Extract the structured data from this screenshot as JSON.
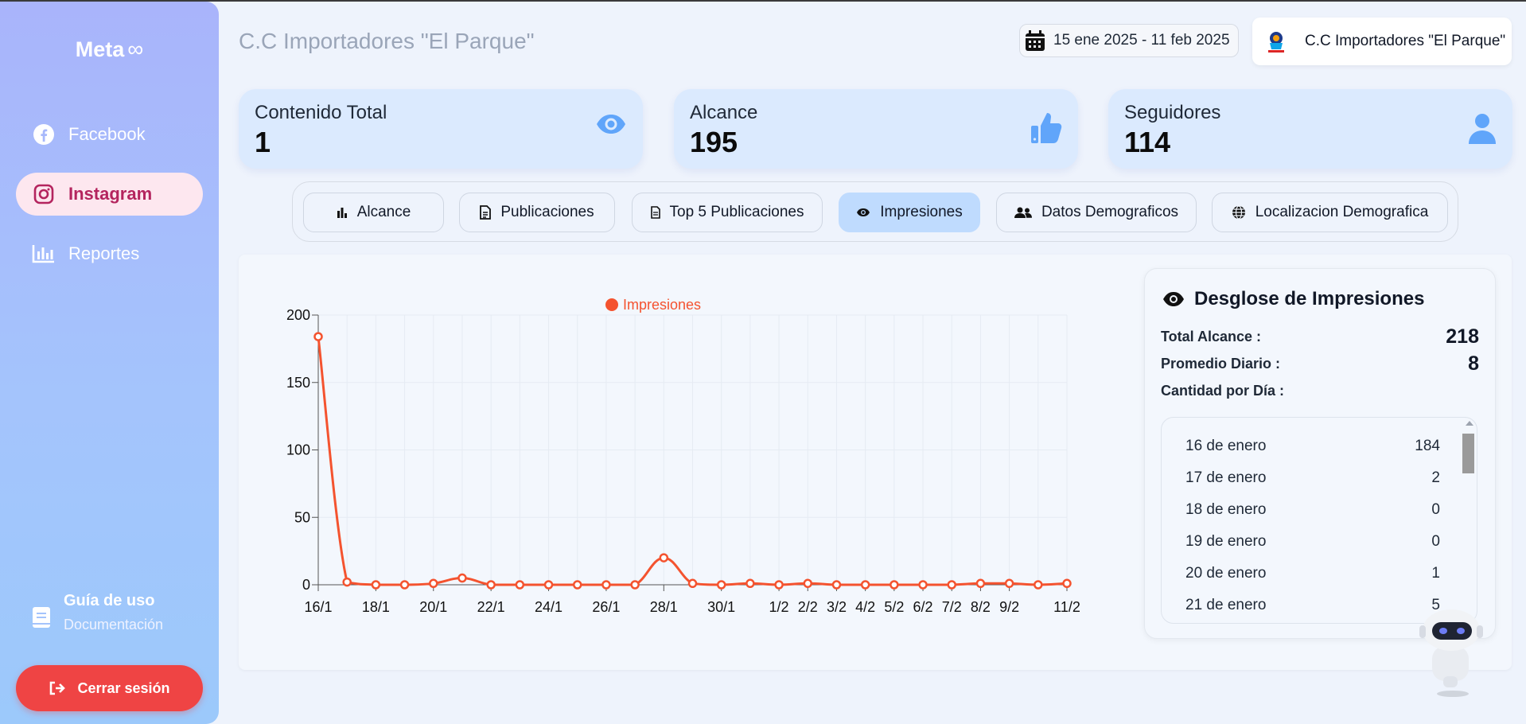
{
  "sidebar": {
    "brand": "Meta",
    "brand_symbol": "∞",
    "items": [
      {
        "label": "Facebook",
        "icon": "facebook-icon",
        "active": false
      },
      {
        "label": "Instagram",
        "icon": "instagram-icon",
        "active": true
      },
      {
        "label": "Reportes",
        "icon": "bar-chart-icon",
        "active": false
      }
    ],
    "guide": {
      "title": "Guía de uso",
      "subtitle": "Documentación"
    },
    "logout": "Cerrar sesión"
  },
  "header": {
    "title": "C.C Importadores \"El Parque\"",
    "date_range": "15 ene 2025 - 11 feb 2025",
    "account_name": "C.C Importadores \"El Parque\""
  },
  "kpis": [
    {
      "label": "Contenido Total",
      "value": "1",
      "icon": "eye-icon"
    },
    {
      "label": "Alcance",
      "value": "195",
      "icon": "thumbs-up-icon"
    },
    {
      "label": "Seguidores",
      "value": "114",
      "icon": "user-icon"
    }
  ],
  "tabs": [
    {
      "label": "Alcance",
      "icon": "bar-chart-icon",
      "active": false
    },
    {
      "label": "Publicaciones",
      "icon": "document-icon",
      "active": false
    },
    {
      "label": "Top 5 Publicaciones",
      "icon": "document-icon",
      "active": false
    },
    {
      "label": "Impresiones",
      "icon": "eye-icon",
      "active": true
    },
    {
      "label": "Datos Demograficos",
      "icon": "users-icon",
      "active": false
    },
    {
      "label": "Localizacion Demografica",
      "icon": "globe-icon",
      "active": false
    }
  ],
  "chart_data": {
    "type": "line",
    "x": [
      "16/1",
      "17/1",
      "18/1",
      "19/1",
      "20/1",
      "21/1",
      "22/1",
      "23/1",
      "24/1",
      "25/1",
      "26/1",
      "27/1",
      "28/1",
      "29/1",
      "30/1",
      "31/1",
      "1/2",
      "2/2",
      "3/2",
      "4/2",
      "5/2",
      "6/2",
      "7/2",
      "8/2",
      "9/2",
      "10/2",
      "11/2"
    ],
    "tick_labels": [
      "16/1",
      "",
      "18/1",
      "",
      "20/1",
      "",
      "22/1",
      "",
      "24/1",
      "",
      "26/1",
      "",
      "28/1",
      "",
      "30/1",
      "",
      "1/2",
      "2/2",
      "3/2",
      "4/2",
      "5/2",
      "6/2",
      "7/2",
      "8/2",
      "9/2",
      "",
      "11/2"
    ],
    "series": [
      {
        "name": "Impresiones",
        "color": "#f4532f",
        "values": [
          184,
          2,
          0,
          0,
          1,
          5,
          0,
          0,
          0,
          0,
          0,
          0,
          20,
          1,
          0,
          1,
          0,
          1,
          0,
          0,
          0,
          0,
          0,
          1,
          1,
          0,
          1
        ]
      }
    ],
    "ylim": [
      0,
      200
    ],
    "yticks": [
      0,
      50,
      100,
      150,
      200
    ],
    "grid": true,
    "legend": "top-center"
  },
  "breakdown": {
    "title": "Desglose de Impresiones",
    "total_label": "Total Alcance :",
    "total_value": "218",
    "avg_label": "Promedio Diario :",
    "avg_value": "8",
    "per_day_label": "Cantidad por Día :",
    "days": [
      {
        "date": "16 de enero",
        "value": "184"
      },
      {
        "date": "17 de enero",
        "value": "2"
      },
      {
        "date": "18 de enero",
        "value": "0"
      },
      {
        "date": "19 de enero",
        "value": "0"
      },
      {
        "date": "20 de enero",
        "value": "1"
      },
      {
        "date": "21 de enero",
        "value": "5"
      }
    ]
  },
  "colors": {
    "accent": "#f4532f",
    "active_tab": "#bfdbfe",
    "kpi_bg": "#dbeafe",
    "logout": "#ef4444",
    "instagram_active": "#b4245e"
  }
}
